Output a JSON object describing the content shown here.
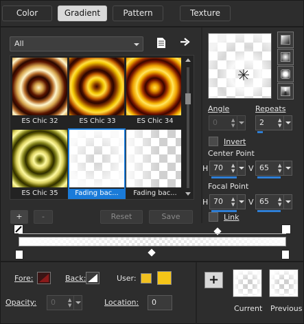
{
  "tabs": [
    {
      "label": "Color"
    },
    {
      "label": "Gradient",
      "active": true
    },
    {
      "label": "Pattern"
    },
    {
      "label": "Texture"
    }
  ],
  "browser": {
    "category": "All",
    "items": [
      {
        "label": "ES Chic 32",
        "style": "brown-rings"
      },
      {
        "label": "ES Chic 33",
        "style": "gold-rings"
      },
      {
        "label": "ES Chic 34",
        "style": "red-gold-rings"
      },
      {
        "label": "ES Chic 35",
        "style": "olive-rings"
      },
      {
        "label": "Fading bac...",
        "style": "fading",
        "selected": true
      },
      {
        "label": "Fading bac...",
        "style": "fading"
      }
    ]
  },
  "buttons": {
    "add": "+",
    "remove": "-",
    "reset": "Reset",
    "save": "Save"
  },
  "settings": {
    "angle_label": "Angle",
    "angle_value": "0",
    "repeats_label": "Repeats",
    "repeats_value": "2",
    "invert_label": "Invert",
    "center_point_label": "Center Point",
    "focal_point_label": "Focal Point",
    "h_label": "H",
    "v_label": "V",
    "center_h": "70",
    "center_v": "65",
    "focal_h": "70",
    "focal_v": "65",
    "link_label": "Link"
  },
  "bottom": {
    "fore_label": "Fore:",
    "back_label": "Back:",
    "user_label": "User:",
    "opacity_label": "Opacity:",
    "opacity_value": "0",
    "location_label": "Location:",
    "location_value": "0",
    "current_label": "Current",
    "previous_label": "Previous",
    "add_symbol": "+"
  },
  "colors": {
    "accent": "#1a7bd9",
    "fore": "#8b1a1a",
    "user1": "#f0c020",
    "user2": "#f5c518"
  }
}
